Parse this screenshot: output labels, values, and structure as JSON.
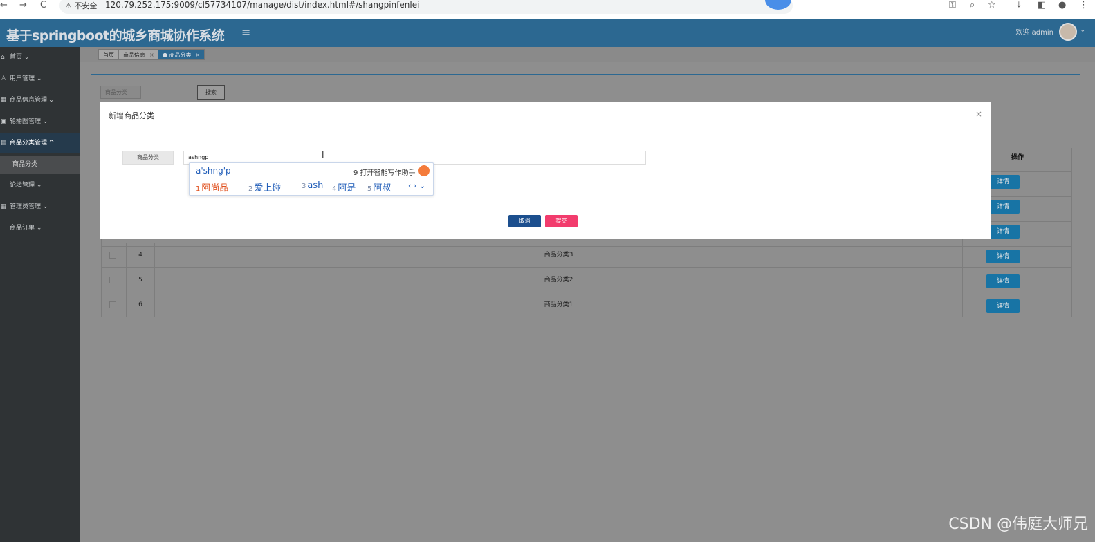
{
  "browser": {
    "back": "←",
    "forward": "→",
    "reload": "C",
    "security": "⚠ 不安全",
    "url": "120.79.252.175:9009/cl57734107/manage/dist/index.html#/shangpinfenlei"
  },
  "header": {
    "title": "基于springboot的城乡商城协作系统",
    "menu_icon": "≡",
    "welcome": "欢迎 admin",
    "chevron": "⌄"
  },
  "sidebar": {
    "items": [
      {
        "label": "首页 ⌄",
        "icon": "⌂"
      },
      {
        "label": "用户管理 ⌄",
        "icon": "♙"
      },
      {
        "label": "商品信息管理 ⌄",
        "icon": "▦"
      },
      {
        "label": "轮播图管理 ⌄",
        "icon": "▣"
      },
      {
        "label": "商品分类管理 ^",
        "icon": "▤"
      },
      {
        "label": "论坛管理 ⌄",
        "icon": ""
      },
      {
        "label": "管理员管理 ⌄",
        "icon": "▦"
      },
      {
        "label": "商品订单 ⌄",
        "icon": ""
      }
    ],
    "sub_item": "商品分类"
  },
  "tabs": [
    {
      "label": "首页",
      "close": ""
    },
    {
      "label": "商品信息",
      "close": "×"
    },
    {
      "label": "● 商品分类",
      "close": "×"
    }
  ],
  "search": {
    "placeholder": "商品分类",
    "button": "搜索"
  },
  "table": {
    "op_header": "操作",
    "detail_label": "详情",
    "rows": [
      {
        "index": "4",
        "name": "商品分类3"
      },
      {
        "index": "5",
        "name": "商品分类2"
      },
      {
        "index": "6",
        "name": "商品分类1"
      }
    ]
  },
  "modal": {
    "title": "新增商品分类",
    "close": "×",
    "field_label": "商品分类",
    "field_value": "ashngp",
    "cancel": "取消",
    "submit": "提交"
  },
  "ime": {
    "pinyin": "a'shng'p",
    "assist": "9 打开智能写作助手",
    "candidates": [
      {
        "n": "1",
        "text": "阿尚品"
      },
      {
        "n": "2",
        "text": "爱上碰"
      },
      {
        "n": "3",
        "text": "ash"
      },
      {
        "n": "4",
        "text": "阿是"
      },
      {
        "n": "5",
        "text": "阿叔"
      }
    ],
    "arrows": "‹ › ⌄"
  },
  "watermark": "CSDN @伟庭大师兄"
}
